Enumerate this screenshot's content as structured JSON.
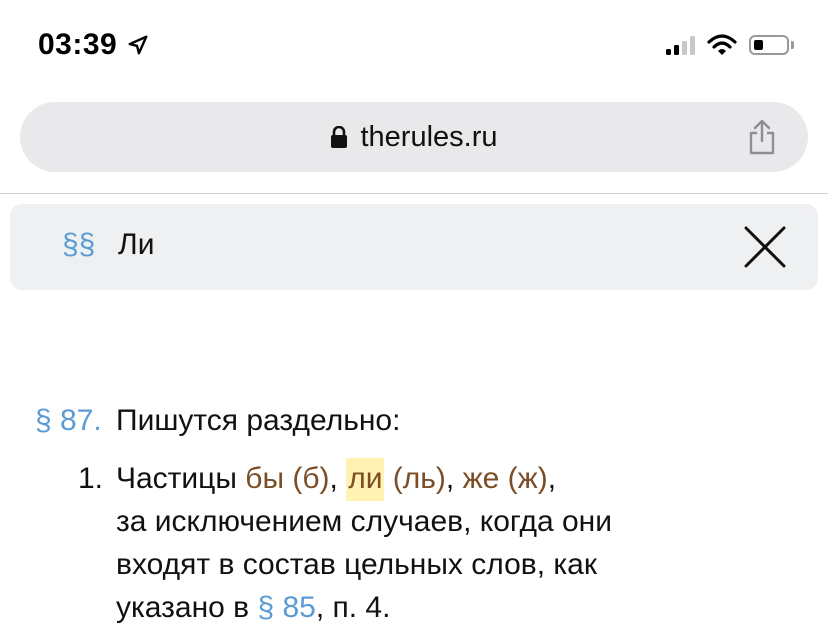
{
  "status_bar": {
    "time": "03:39"
  },
  "browser": {
    "url": "therules.ru"
  },
  "search": {
    "mark": "§§",
    "query": "Ли"
  },
  "article": {
    "paragraph_number": "§ 87.",
    "paragraph_title": "Пишутся раздельно:",
    "item_number": "1.",
    "line1_a": "Частицы ",
    "p_by": "бы (б)",
    "comma1": ", ",
    "p_li": "ли",
    "space1": " ",
    "p_l": "(ль)",
    "comma2": ", ",
    "p_zhe": "же (ж)",
    "comma3": ",",
    "line2": "за исключением случаев, когда они",
    "line3": "входят в состав цельных слов, как",
    "line4_a": "указано в ",
    "ref": "§ 85",
    "line4_b": ", п. 4."
  },
  "colors": {
    "link": "#5b9bd5",
    "particle": "#7a4e26",
    "highlight": "#fff2b3"
  }
}
